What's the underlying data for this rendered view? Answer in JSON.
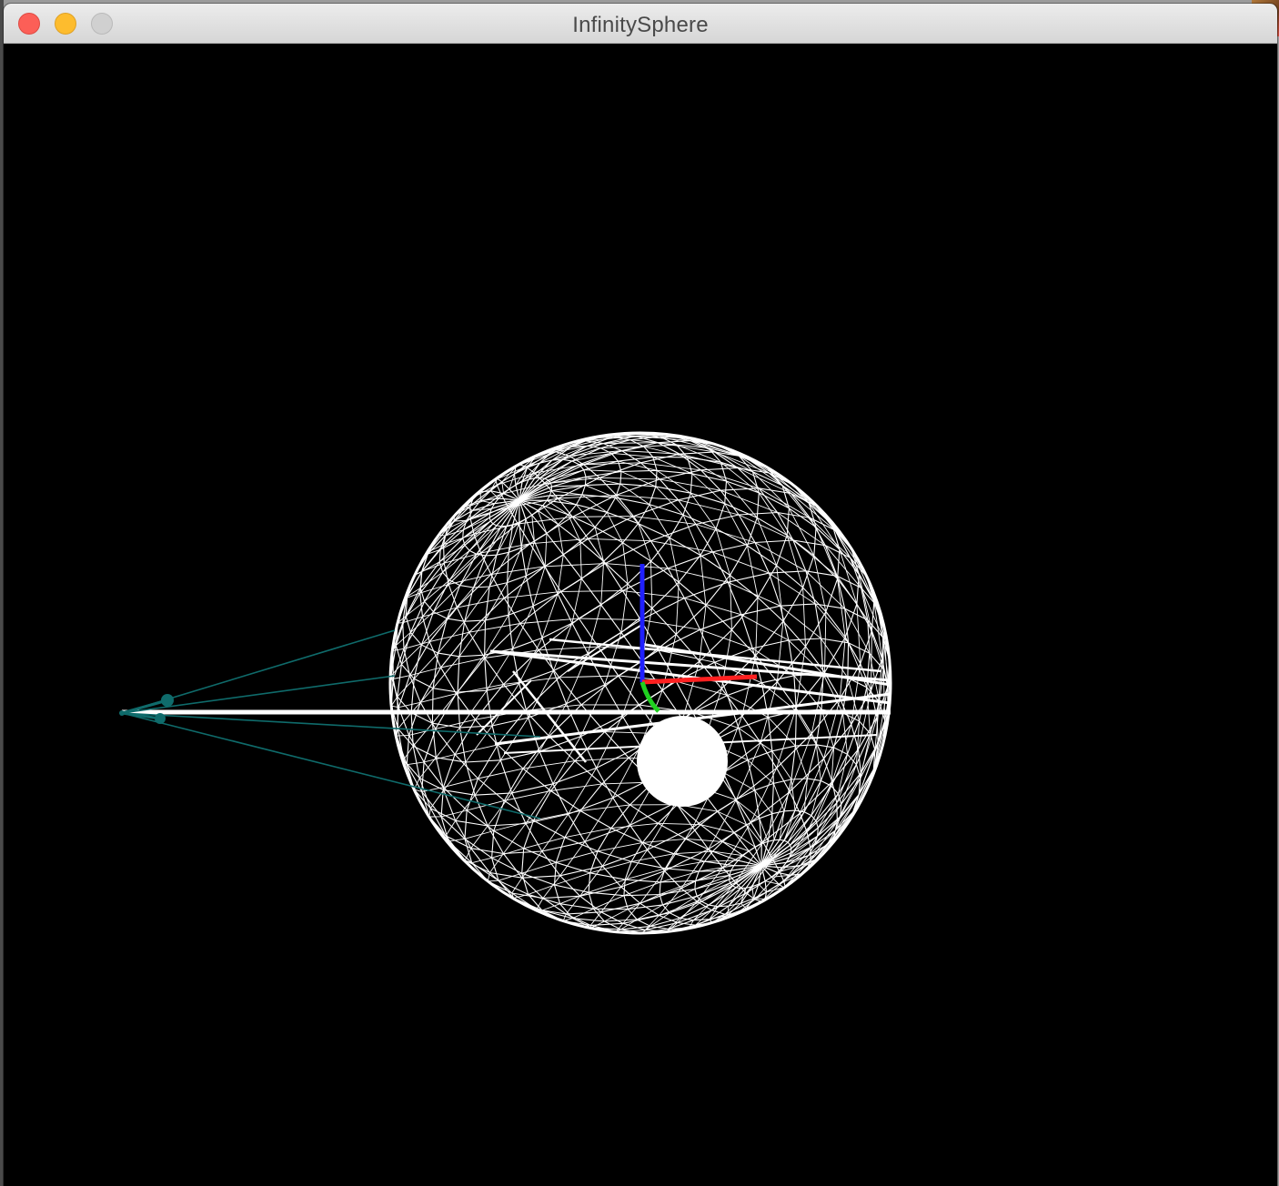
{
  "window": {
    "title": "InfinitySphere",
    "controls": {
      "close": "close-button",
      "minimize": "minimize-button",
      "zoom": "zoom-button"
    }
  },
  "scene": {
    "background_color": "#000000",
    "wireframe_color": "#ffffff",
    "axis_colors": {
      "x": "#ff2020",
      "y": "#20d020",
      "z": "#2020ff"
    },
    "camera_frustum_color": "#0f6b6b",
    "icons": [
      "wireframe-sphere",
      "axis-gizmo",
      "camera-frustum",
      "solid-sphere"
    ]
  }
}
